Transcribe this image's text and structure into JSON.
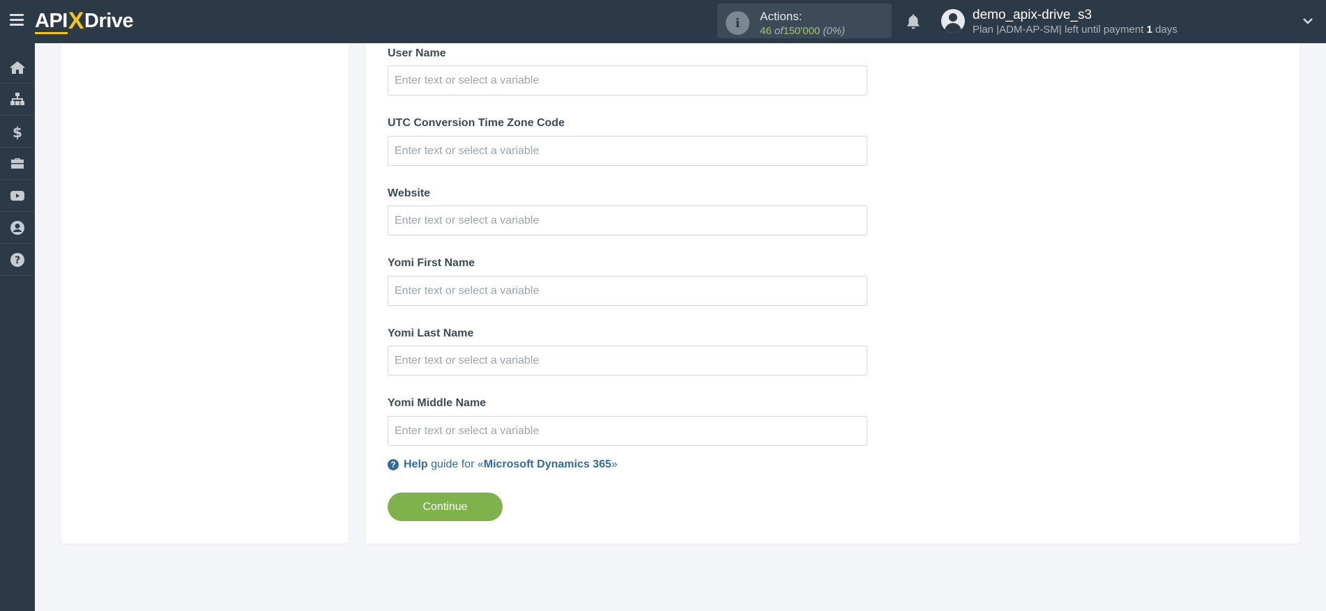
{
  "header": {
    "logo_left": "API",
    "logo_x": "X",
    "logo_right": "Drive",
    "actions_label": "Actions:",
    "actions_used": "46",
    "actions_of": "of",
    "actions_total": "150'000",
    "actions_pct": "(0%)",
    "user_name": "demo_apix-drive_s3",
    "plan_prefix": "Plan |ADM-AP-SM| left until payment",
    "plan_days": "1",
    "plan_suffix": "days"
  },
  "sidebar": {
    "items": [
      {
        "icon": "home-icon"
      },
      {
        "icon": "sitemap-icon"
      },
      {
        "icon": "dollar-icon"
      },
      {
        "icon": "briefcase-icon"
      },
      {
        "icon": "youtube-icon"
      },
      {
        "icon": "user-circle-icon"
      },
      {
        "icon": "question-circle-icon"
      }
    ]
  },
  "form": {
    "placeholder": "Enter text or select a variable",
    "fields": [
      {
        "label": "User Name",
        "value": ""
      },
      {
        "label": "UTC Conversion Time Zone Code",
        "value": ""
      },
      {
        "label": "Website",
        "value": ""
      },
      {
        "label": "Yomi First Name",
        "value": ""
      },
      {
        "label": "Yomi Last Name",
        "value": ""
      },
      {
        "label": "Yomi Middle Name",
        "value": ""
      }
    ]
  },
  "help": {
    "help_word": "Help",
    "guide_for": "guide for «",
    "product": "Microsoft Dynamics 365",
    "close_quote": "»"
  },
  "actions": {
    "continue_label": "Continue"
  },
  "colors": {
    "topbar": "#2c3a48",
    "accent_green": "#7fb24a",
    "link_blue": "#2f6aa0",
    "logo_yellow": "#f5c518"
  }
}
